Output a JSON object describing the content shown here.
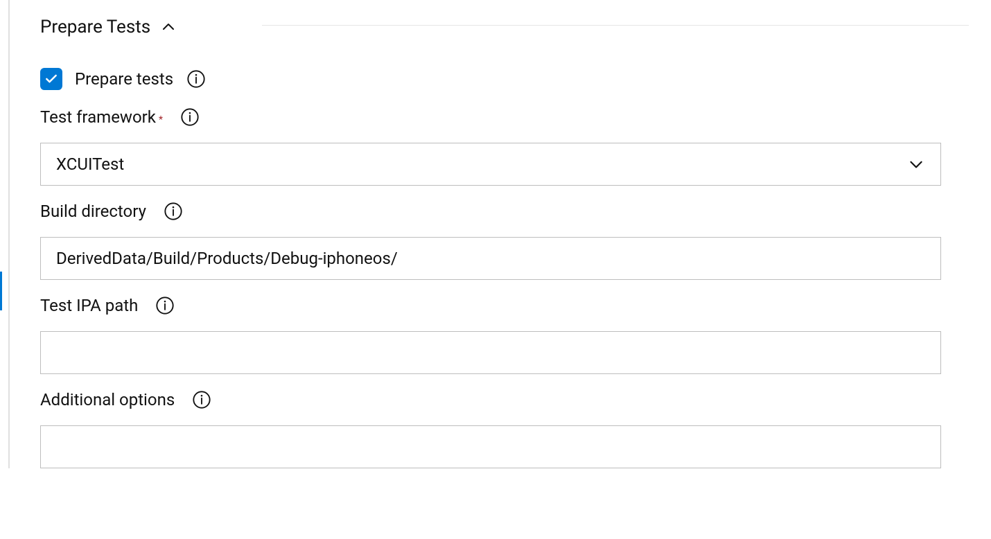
{
  "section": {
    "title": "Prepare Tests"
  },
  "prepare_tests": {
    "checkbox_label": "Prepare tests",
    "checked": true
  },
  "test_framework": {
    "label": "Test framework",
    "required": true,
    "selected": "XCUITest"
  },
  "build_directory": {
    "label": "Build directory",
    "value": "DerivedData/Build/Products/Debug-iphoneos/"
  },
  "test_ipa_path": {
    "label": "Test IPA path",
    "value": ""
  },
  "additional_options": {
    "label": "Additional options",
    "value": ""
  }
}
